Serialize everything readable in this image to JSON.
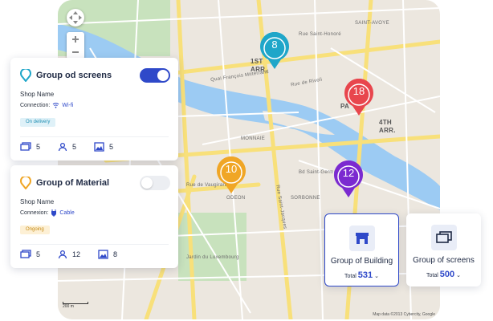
{
  "map": {
    "districts": [
      "1ST",
      "ARR.",
      "SAINT-AVOYE",
      "MONNAIE",
      "ODEON",
      "SORBONNE",
      "4TH",
      "ARR.",
      "PA"
    ],
    "streets": [
      "Rue Saint-Honoré",
      "Quai François Mitterrand",
      "Rue de Rivoli",
      "Rue de Vaugirard",
      "Rue Saint-Jacques",
      "Bd Saint-Germain",
      "Jardin du Luxembourg"
    ],
    "scale_text": "200 m",
    "copyright": "Map data ©2013 Cybercity, Google"
  },
  "pins": [
    {
      "label": "8",
      "color": "#1fa6c9"
    },
    {
      "label": "18",
      "color": "#e8464d"
    },
    {
      "label": "10",
      "color": "#f0a626"
    },
    {
      "label": "12",
      "color": "#7b2ad0"
    }
  ],
  "card_screens": {
    "title": "Group od screens",
    "shop": "Shop Name",
    "connection_label": "Connection:",
    "connection_value": "Wi-fi",
    "badge": "On delivery",
    "toggle_on": true,
    "stats": [
      {
        "icon": "screen-icon",
        "value": "5"
      },
      {
        "icon": "user-icon",
        "value": "5"
      },
      {
        "icon": "image-icon",
        "value": "5"
      }
    ]
  },
  "card_material": {
    "title": "Group of Material",
    "shop": "Shop Name",
    "connection_label": "Connexion:",
    "connection_value": "Cable",
    "badge": "Ongoing",
    "toggle_on": false,
    "stats": [
      {
        "icon": "screen-icon",
        "value": "5"
      },
      {
        "icon": "user-icon",
        "value": "12"
      },
      {
        "icon": "image-icon",
        "value": "8"
      }
    ]
  },
  "group_building": {
    "name": "Group of Building",
    "total_label": "Total",
    "total": "531"
  },
  "group_screens": {
    "name": "Group of screens",
    "total_label": "Total",
    "total": "500"
  },
  "colors": {
    "accent": "#2f49c9",
    "teal": "#1fa6c9",
    "orange": "#f0a626"
  }
}
